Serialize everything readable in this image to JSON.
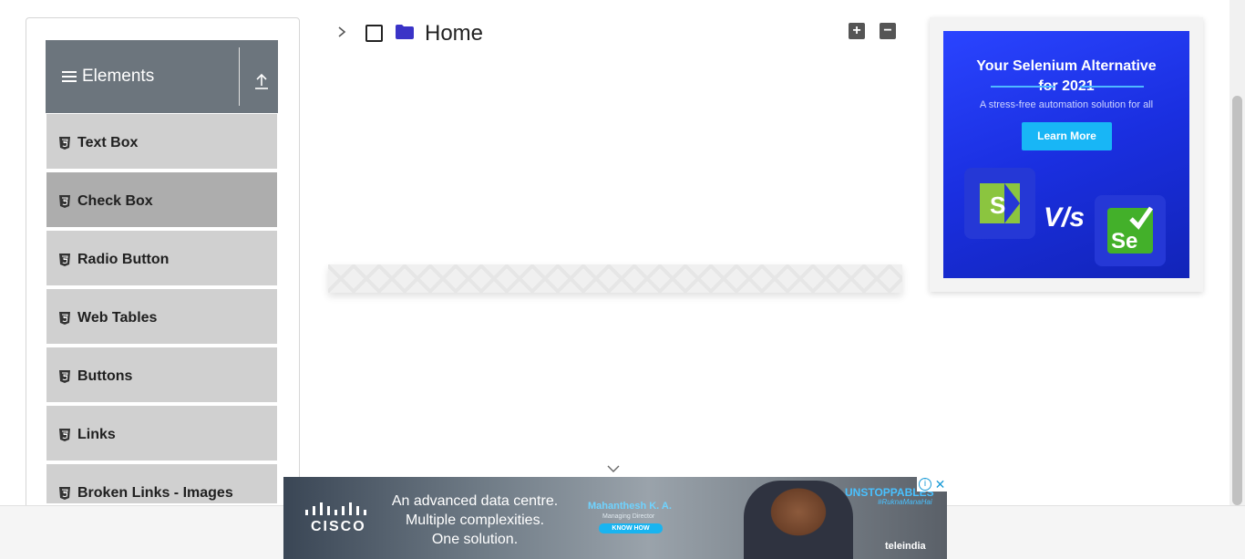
{
  "sidebar": {
    "group_title": "Elements",
    "items": [
      {
        "label": "Text Box"
      },
      {
        "label": "Check Box"
      },
      {
        "label": "Radio Button"
      },
      {
        "label": "Web Tables"
      },
      {
        "label": "Buttons"
      },
      {
        "label": "Links"
      },
      {
        "label": "Broken Links - Images"
      }
    ],
    "active_item": "Check Box"
  },
  "tree": {
    "root_label": "Home",
    "expand_all_symbol": "+",
    "collapse_all_symbol": "−"
  },
  "ad_right": {
    "title_line1": "Your Selenium Alternative",
    "title_line2": "for 2021",
    "subtitle": "A stress-free automation solution for all",
    "button": "Learn More",
    "vs_text": "V/s",
    "logo_left_letter": "S",
    "logo_right_letters": "Se"
  },
  "banner_ad": {
    "brand": "CISCO",
    "copy_line1": "An advanced data centre.",
    "copy_line2": "Multiple complexities.",
    "copy_line3": "One solution.",
    "person_name": "Mahanthesh K. A.",
    "person_role": "Managing Director",
    "cta": "KNOW HOW",
    "campaign": "UNSTOPPABLES",
    "hashtag": "#RuknaManaHai",
    "partner": "teleindia",
    "info_symbol": "i",
    "close_symbol": "✕"
  },
  "colors": {
    "sidebar_header": "#6c757d",
    "menu_item": "#d0d0d0",
    "menu_item_active": "#adadad",
    "folder": "#3a33c7",
    "ad_blue": "#1f34e8",
    "ad_button": "#18b6f6"
  }
}
